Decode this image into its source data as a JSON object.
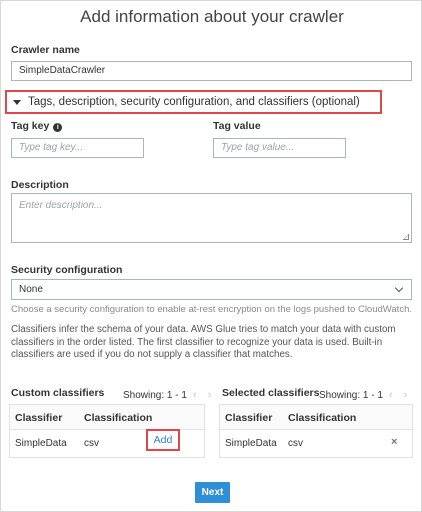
{
  "header": {
    "title": "Add information about your crawler"
  },
  "crawler_name": {
    "label": "Crawler name",
    "value": "SimpleDataCrawler"
  },
  "optional_section": {
    "label": "Tags, description, security configuration, and classifiers (optional)"
  },
  "tags": {
    "key_label": "Tag key",
    "key_placeholder": "Type tag key...",
    "value_label": "Tag value",
    "value_placeholder": "Type tag value..."
  },
  "description": {
    "label": "Description",
    "placeholder": "Enter description..."
  },
  "security": {
    "label": "Security configuration",
    "selected": "None",
    "help": "Choose a security configuration to enable at-rest encryption on the logs pushed to CloudWatch."
  },
  "classifiers_info": "Classifiers infer the schema of your data. AWS Glue tries to match your data with custom classifiers in the order listed. The first classifier to recognize your data is used. Built-in classifiers are used if you do not supply a classifier that matches.",
  "custom_classifiers": {
    "title": "Custom classifiers",
    "showing": "Showing: 1 - 1",
    "columns": [
      "Classifier",
      "Classification"
    ],
    "rows": [
      {
        "classifier": "SimpleData",
        "classification": "csv",
        "action": "Add"
      }
    ]
  },
  "selected_classifiers": {
    "title": "Selected classifiers",
    "showing": "Showing: 1 - 1",
    "columns": [
      "Classifier",
      "Classification"
    ],
    "rows": [
      {
        "classifier": "SimpleData",
        "classification": "csv",
        "action": "×"
      }
    ]
  },
  "footer": {
    "next_label": "Next"
  },
  "colors": {
    "accent": "#2e8ed7",
    "highlight": "#e0464b",
    "link": "#2f7fd1"
  }
}
